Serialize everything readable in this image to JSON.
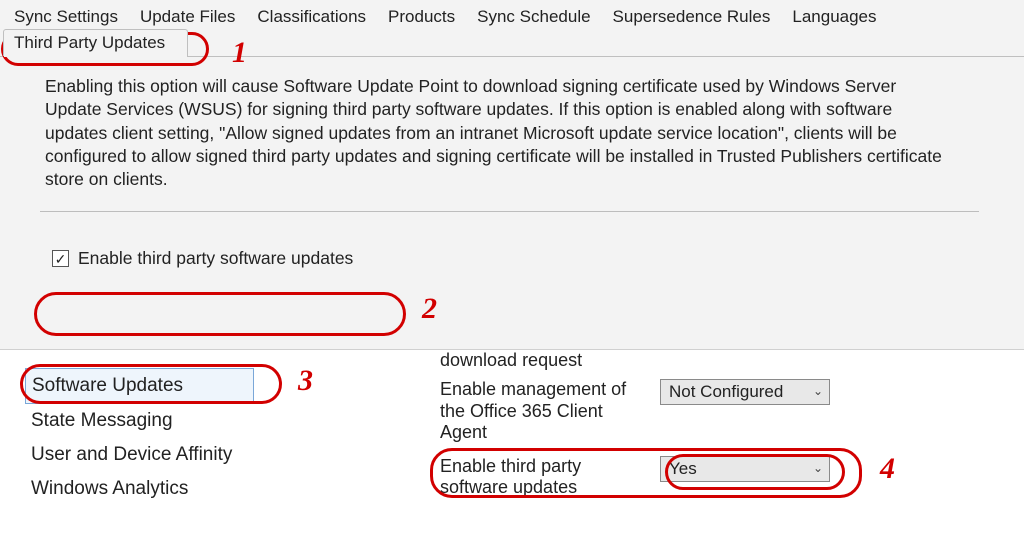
{
  "tabs": {
    "sync_settings": "Sync Settings",
    "update_files": "Update Files",
    "classifications": "Classifications",
    "products": "Products",
    "sync_schedule": "Sync Schedule",
    "supersedence_rules": "Supersedence Rules",
    "languages": "Languages",
    "third_party_updates": "Third Party Updates"
  },
  "description": "Enabling this option will cause Software Update Point to download signing certificate used by Windows Server Update Services (WSUS) for signing third party software updates. If this option is enabled along with software updates client setting, \"Allow signed updates from an intranet Microsoft update service location\", clients will be configured to allow signed third party updates and signing certificate will be installed in Trusted Publishers certificate store on clients.",
  "checkbox": {
    "label": "Enable third party software updates",
    "checked_glyph": "✓"
  },
  "lower": {
    "nav": {
      "software_updates": "Software Updates",
      "state_messaging": "State Messaging",
      "user_device_affinity": "User and Device Affinity",
      "windows_analytics": "Windows Analytics"
    },
    "partial_top": "download request",
    "settings": {
      "o365_label": "Enable management of the Office 365 Client Agent",
      "o365_value": "Not Configured",
      "tpsu_label": "Enable third party software updates",
      "tpsu_value": "Yes"
    }
  },
  "annotations": {
    "n1": "1",
    "n2": "2",
    "n3": "3",
    "n4": "4"
  },
  "glyphs": {
    "chevron_down": "⌄"
  }
}
